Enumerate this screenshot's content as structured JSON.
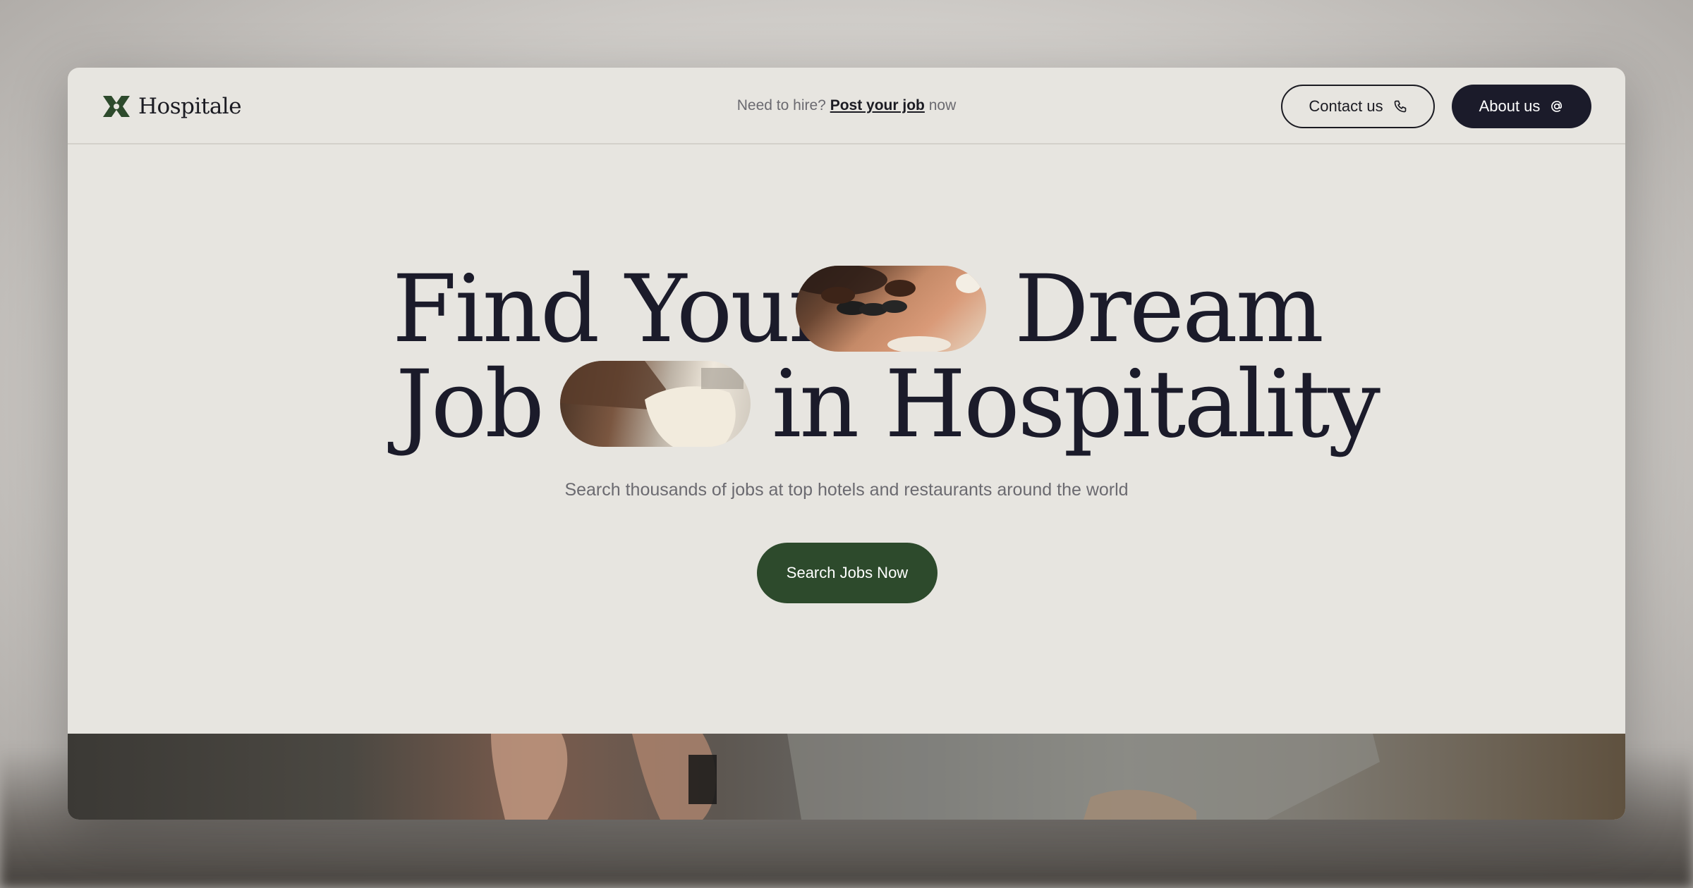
{
  "brand": {
    "name": "Hospitale",
    "accent": "#2d4a2c",
    "dark": "#1b1b2a"
  },
  "nav": {
    "hire_prefix": "Need to hire?",
    "hire_link": "Post your job",
    "hire_suffix": "now",
    "contact_label": "Contact us",
    "contact_icon": "phone-icon",
    "about_label": "About us",
    "about_icon": "at-sign-icon"
  },
  "hero": {
    "line1": {
      "left": "Find Your",
      "right": "Dream"
    },
    "line2": {
      "left": "Job",
      "right": "in Hospitality"
    },
    "subtitle": "Search thousands of jobs at top hotels and restaurants around the world",
    "cta_label": "Search Jobs Now"
  }
}
